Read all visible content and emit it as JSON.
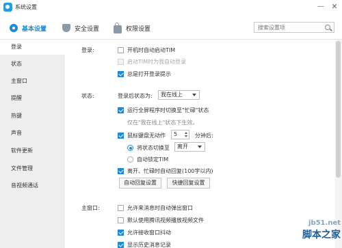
{
  "window": {
    "title": "系统设置",
    "minimize": "—",
    "close": "✕"
  },
  "tabs": [
    {
      "label": "基本设置",
      "icon": "gear-icon"
    },
    {
      "label": "安全设置",
      "icon": "shield-icon"
    },
    {
      "label": "权限设置",
      "icon": "lock-icon"
    }
  ],
  "search": {
    "placeholder": "搜索设置项"
  },
  "sidebar": {
    "items": [
      {
        "label": "登录"
      },
      {
        "label": "状态"
      },
      {
        "label": "主窗口"
      },
      {
        "label": "提醒"
      },
      {
        "label": "热键"
      },
      {
        "label": "声音"
      },
      {
        "label": "软件更新"
      },
      {
        "label": "文件管理"
      },
      {
        "label": "音视频通话"
      }
    ]
  },
  "login": {
    "label": "登录:",
    "auto_start": "开机时自动启动TIM",
    "auto_login": "启动TIM时为我自动登录",
    "always_open_prompt": "总是打开登录提示"
  },
  "status": {
    "label": "状态:",
    "after_login_label": "登录后状态为:",
    "after_login_value": "我在线上",
    "fullscreen_busy": "运行全屏程序时切换至\"忙碌\"状态",
    "fullscreen_hint": "仅在\"我在线上\"状态下生效。",
    "idle_label": "鼠标键盘无动作",
    "idle_minutes": "5",
    "idle_suffix": "分钟后:",
    "switch_label": "将状态切换至",
    "switch_value": "离开",
    "auto_lock": "自动锁定TIM",
    "auto_reply": "离开、忙碌时自动回复(100字以内)",
    "auto_reply_btn": "自动回复设置",
    "quick_reply_btn": "快捷回复设置"
  },
  "main_window": {
    "label": "主窗口:",
    "popup_on_msg": "允许来消息时自动弹出窗口",
    "tencent_video": "默认使用腾讯视频播放视频文件",
    "allow_shake": "允许接收窗口抖动",
    "show_history": "显示历史消息记录"
  },
  "watermark": {
    "line1": "jb51.net",
    "line2": "脚本之家"
  }
}
